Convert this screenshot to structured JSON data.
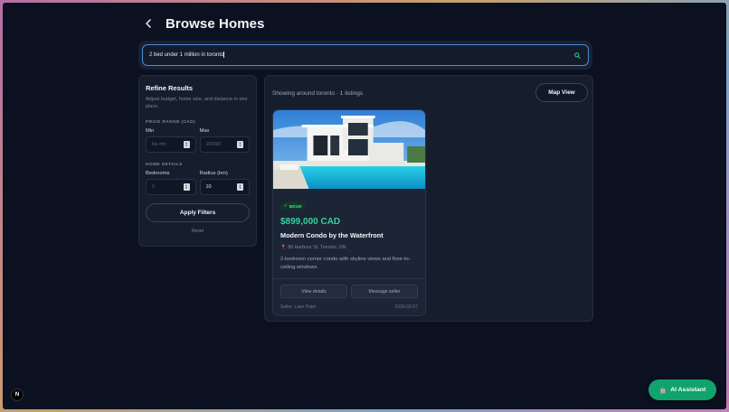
{
  "header": {
    "title": "Browse Homes",
    "back_icon": "chevron-left-icon"
  },
  "search": {
    "value": "2 bed under 1 million in toronto",
    "icon": "search-icon"
  },
  "sidebar": {
    "title": "Refine Results",
    "description": "Adjust budget, home size, and distance in one place.",
    "price_section": "PRICE RANGE (CAD)",
    "min_label": "Min",
    "max_label": "Max",
    "min_placeholder": "No min",
    "max_placeholder": "100000",
    "home_section": "HOME DETAILS",
    "bedrooms_label": "Bedrooms",
    "bedrooms_placeholder": "2",
    "radius_label": "Radius (km)",
    "radius_value": "10",
    "apply_label": "Apply Filters",
    "reset_label": "Reset"
  },
  "results": {
    "summary": "Showing around toronto · 1 listings",
    "map_view_label": "Map View"
  },
  "listing": {
    "score": "88/100",
    "price": "$899,000 CAD",
    "title": "Modern Condo by the Waterfront",
    "address": "88 Harbour St, Toronto, ON",
    "description": "2-bedroom corner condo with skyline views and floor-to-ceiling windows.",
    "view_details_label": "View details",
    "message_seller_label": "Message seller",
    "seller": "Seller: Liam Patel",
    "date": "2026-03-07"
  },
  "dev_badge": "N",
  "ai_assistant": {
    "label": "AI Assistant",
    "icon": "robot-icon"
  },
  "colors": {
    "accent_green": "#10a36e",
    "price_green": "#34d399",
    "background": "#0b1120",
    "search_border": "#4b8bd8"
  }
}
